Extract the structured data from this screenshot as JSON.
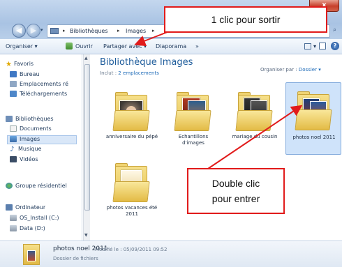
{
  "window": {
    "close_glyph": "x"
  },
  "address_bar": {
    "crumbs": [
      "Bibliothèques",
      "Images"
    ],
    "separator": "▸",
    "search_glyph": "⌕"
  },
  "toolbar": {
    "organize": "Organiser ▾",
    "open": "Ouvrir",
    "share": "Partager avec ▾",
    "slideshow": "Diaporama",
    "more": "»",
    "view_dropdown": "▾",
    "help": "?"
  },
  "nav": {
    "favorites": "Favoris",
    "desktop": "Bureau",
    "recent_places": "Emplacements ré",
    "downloads": "Téléchargements",
    "libraries": "Bibliothèques",
    "documents": "Documents",
    "images": "Images",
    "music": "Musique",
    "videos": "Vidéos",
    "homegroup": "Groupe résidentiel",
    "computer": "Ordinateur",
    "drive_c": "OS_Install (C:)",
    "drive_d": "Data (D:)"
  },
  "content": {
    "title": "Bibliothèque Images",
    "includes_prefix": "Inclut :",
    "includes_link": "2 emplacements",
    "arrange_label": "Organiser par :",
    "arrange_value": "Dossier ▾",
    "folders": [
      {
        "label": "anniversaire du pépé"
      },
      {
        "label": "Echantillons d'images"
      },
      {
        "label": "mariage du cousin"
      },
      {
        "label": "photos noel 2011"
      },
      {
        "label": "photos vacances été 2011"
      }
    ]
  },
  "details": {
    "name": "photos noel 2011",
    "modified": "Modifié le : 05/09/2011 09:52",
    "type": "Dossier de fichiers"
  },
  "annotations": {
    "exit_text": "1 clic pour sortir",
    "enter_line1": "Double clic",
    "enter_line2": "pour entrer",
    "color": "#e11b1b"
  }
}
